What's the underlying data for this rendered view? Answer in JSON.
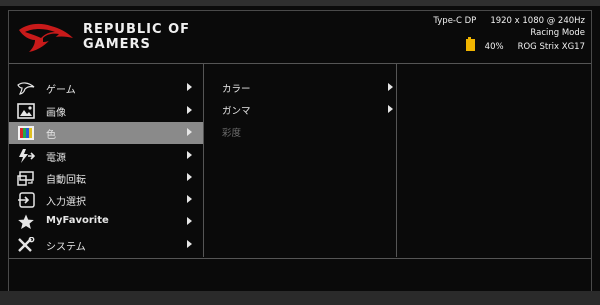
{
  "header": {
    "brand_line1": "REPUBLIC OF",
    "brand_line2": "GAMERS",
    "input": "Type-C DP",
    "resolution": "1920 x 1080 @",
    "refresh": "240Hz",
    "mode": "Racing Mode",
    "battery": "40%",
    "model": "ROG Strix XG17",
    "battery_color": "#f0b400"
  },
  "menu": [
    {
      "label": "ゲーム",
      "icon": "rog-eye-icon"
    },
    {
      "label": "画像",
      "icon": "image-icon"
    },
    {
      "label": "色",
      "icon": "color-icon",
      "selected": true
    },
    {
      "label": "電源",
      "icon": "power-bolt-icon"
    },
    {
      "label": "自動回転",
      "icon": "rotate-icon"
    },
    {
      "label": "入力選択",
      "icon": "input-icon"
    },
    {
      "label": "MyFavorite",
      "icon": "star-icon"
    },
    {
      "label": "システム",
      "icon": "tools-icon"
    }
  ],
  "submenu": [
    {
      "label": "カラー",
      "enabled": true
    },
    {
      "label": "ガンマ",
      "enabled": true
    },
    {
      "label": "彩度",
      "enabled": false
    }
  ],
  "colors": {
    "selection": "#8a8a8a",
    "disabled": "#6e6e6e"
  }
}
